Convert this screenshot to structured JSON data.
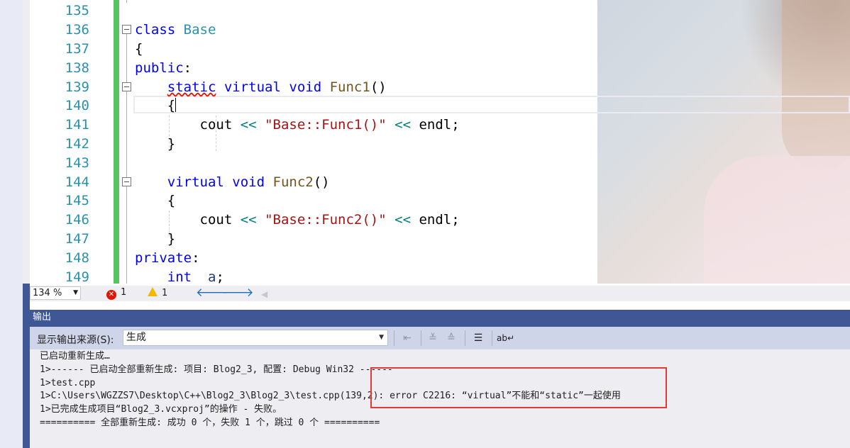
{
  "editor": {
    "lines": [
      {
        "num": "135"
      },
      {
        "num": "136"
      },
      {
        "num": "137"
      },
      {
        "num": "138"
      },
      {
        "num": "139"
      },
      {
        "num": "140"
      },
      {
        "num": "141"
      },
      {
        "num": "142"
      },
      {
        "num": "143"
      },
      {
        "num": "144"
      },
      {
        "num": "145"
      },
      {
        "num": "146"
      },
      {
        "num": "147"
      },
      {
        "num": "148"
      },
      {
        "num": "149"
      }
    ],
    "code": {
      "l136_kw": "class",
      "l136_name": "Base",
      "l137": "{",
      "l138_kw": "public",
      "l138_colon": ":",
      "l139_static": "static",
      "l139_virtual": "virtual",
      "l139_void": "void",
      "l139_fn": "Func1",
      "l139_paren": "()",
      "l140": "{",
      "l141_cout": "cout",
      "l141_op1": "<<",
      "l141_str": "\"Base::Func1()\"",
      "l141_op2": "<<",
      "l141_endl": "endl",
      "l141_semi": ";",
      "l142": "}",
      "l144_virtual": "virtual",
      "l144_void": "void",
      "l144_fn": "Func2",
      "l144_paren": "()",
      "l145": "{",
      "l146_cout": "cout",
      "l146_op1": "<<",
      "l146_str": "\"Base::Func2()\"",
      "l146_op2": "<<",
      "l146_endl": "endl",
      "l146_semi": ";",
      "l147": "}",
      "l148_kw": "private",
      "l148_colon": ":",
      "l149_kw": "int",
      "l149_var": "_a",
      "l149_semi": ";"
    }
  },
  "status": {
    "zoom": "134 %",
    "errors": "1",
    "warnings": "1"
  },
  "output": {
    "title": "输出",
    "source_label": "显示输出来源(S):",
    "source_value": "生成",
    "lines": [
      "已启动重新生成…",
      "1>------ 已启动全部重新生成: 项目: Blog2_3, 配置: Debug Win32 ------",
      "1>test.cpp",
      "1>C:\\Users\\WGZZS7\\Desktop\\C++\\Blog2_3\\Blog2_3\\test.cpp(139,2): error C2216: “virtual”不能和“static”一起使用",
      "1>已完成生成项目“Blog2_3.vcxproj”的操作 - 失败。",
      "========== 全部重新生成: 成功 0 个，失败 1 个，跳过 0 个 =========="
    ]
  },
  "colors": {
    "keyword": "#0000ff",
    "type_name": "#2b91af",
    "string": "#a31515",
    "change_bar": "#56c55f",
    "panel_header": "#3f5794",
    "highlight_box": "#e53935"
  }
}
